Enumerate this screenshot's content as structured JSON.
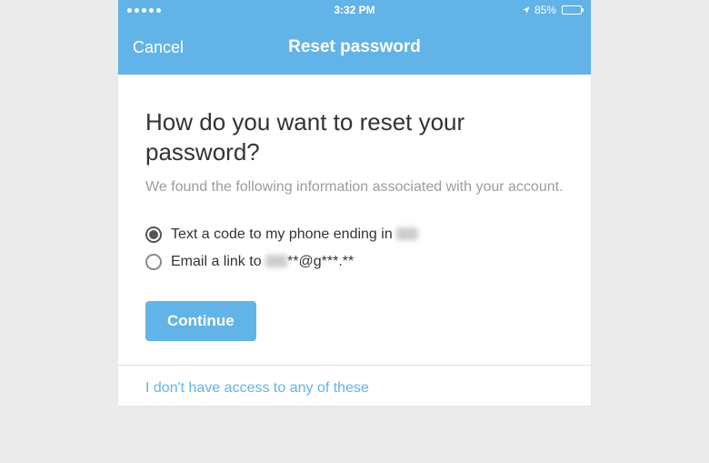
{
  "statusbar": {
    "time": "3:32 PM",
    "battery_pct": "85%"
  },
  "navbar": {
    "cancel": "Cancel",
    "title": "Reset password"
  },
  "main": {
    "headline": "How do you want to reset your password?",
    "subtext": "We found the following information associated with your account.",
    "options": [
      {
        "prefix": "Text a code to my phone ending in ",
        "masked": "",
        "selected": true
      },
      {
        "prefix": "Email a link to ",
        "masked": "**@g***.**",
        "selected": false
      }
    ],
    "continue": "Continue"
  },
  "footer": {
    "no_access": "I don't have access to any of these"
  }
}
